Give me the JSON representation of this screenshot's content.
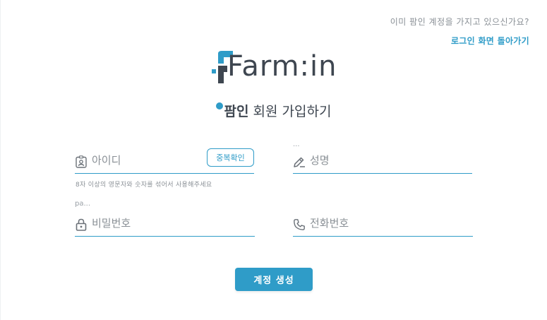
{
  "top_links": {
    "have_account": "이미 팜인 계정을 가지고 있으신가요?",
    "back_to_login": "로그인 화면 돌아가기"
  },
  "logo": {
    "text": "Farm:in"
  },
  "title": {
    "brand": "팜인",
    "rest": " 회원 가입하기"
  },
  "form": {
    "id": {
      "placeholder": "아이디",
      "icon": "id-badge-icon",
      "hint": "8자 이상의 영문자와 숫자를 섞어서 사용해주세요",
      "dup_button": "중복확인"
    },
    "name": {
      "placeholder": "성명",
      "icon": "pen-icon",
      "label": "..."
    },
    "password": {
      "placeholder": "비밀번호",
      "icon": "lock-icon",
      "label": "pa..."
    },
    "phone": {
      "placeholder": "전화번호",
      "icon": "phone-icon"
    },
    "submit": "계정 생성"
  },
  "colors": {
    "accent": "#2f9cc8",
    "text": "#3e4650"
  }
}
